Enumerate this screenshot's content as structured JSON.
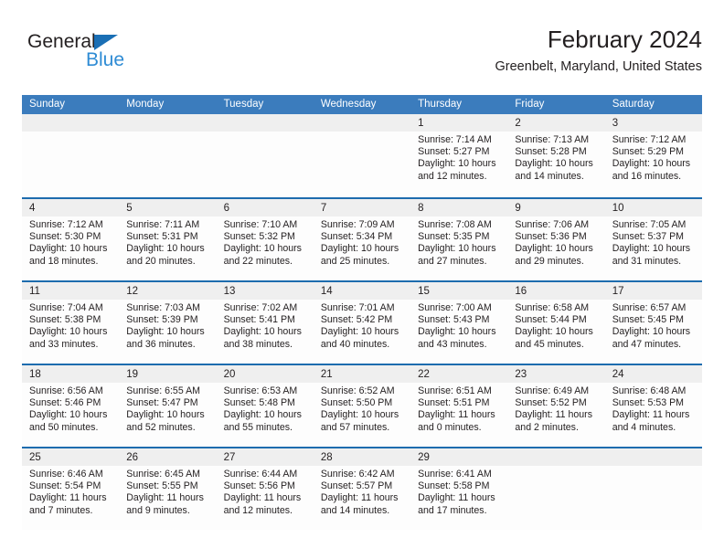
{
  "brand": {
    "name_part1": "General",
    "name_part2": "Blue",
    "triangle_color": "#1a6fb5",
    "text_color": "#231f20",
    "blue_color": "#2e8bd4"
  },
  "header": {
    "title": "February 2024",
    "subtitle": "Greenbelt, Maryland, United States"
  },
  "theme": {
    "header_bg": "#3b7cbd",
    "week_divider": "#1d6cae",
    "date_band_bg": "#efefef",
    "cell_bg": "#fdfdfd",
    "text": "#231f20"
  },
  "calendar": {
    "weekday_headers": [
      "Sunday",
      "Monday",
      "Tuesday",
      "Wednesday",
      "Thursday",
      "Friday",
      "Saturday"
    ],
    "weeks": [
      [
        {
          "date": "",
          "lines": []
        },
        {
          "date": "",
          "lines": []
        },
        {
          "date": "",
          "lines": []
        },
        {
          "date": "",
          "lines": []
        },
        {
          "date": "1",
          "lines": [
            "Sunrise: 7:14 AM",
            "Sunset: 5:27 PM",
            "Daylight: 10 hours",
            "and 12 minutes."
          ]
        },
        {
          "date": "2",
          "lines": [
            "Sunrise: 7:13 AM",
            "Sunset: 5:28 PM",
            "Daylight: 10 hours",
            "and 14 minutes."
          ]
        },
        {
          "date": "3",
          "lines": [
            "Sunrise: 7:12 AM",
            "Sunset: 5:29 PM",
            "Daylight: 10 hours",
            "and 16 minutes."
          ]
        }
      ],
      [
        {
          "date": "4",
          "lines": [
            "Sunrise: 7:12 AM",
            "Sunset: 5:30 PM",
            "Daylight: 10 hours",
            "and 18 minutes."
          ]
        },
        {
          "date": "5",
          "lines": [
            "Sunrise: 7:11 AM",
            "Sunset: 5:31 PM",
            "Daylight: 10 hours",
            "and 20 minutes."
          ]
        },
        {
          "date": "6",
          "lines": [
            "Sunrise: 7:10 AM",
            "Sunset: 5:32 PM",
            "Daylight: 10 hours",
            "and 22 minutes."
          ]
        },
        {
          "date": "7",
          "lines": [
            "Sunrise: 7:09 AM",
            "Sunset: 5:34 PM",
            "Daylight: 10 hours",
            "and 25 minutes."
          ]
        },
        {
          "date": "8",
          "lines": [
            "Sunrise: 7:08 AM",
            "Sunset: 5:35 PM",
            "Daylight: 10 hours",
            "and 27 minutes."
          ]
        },
        {
          "date": "9",
          "lines": [
            "Sunrise: 7:06 AM",
            "Sunset: 5:36 PM",
            "Daylight: 10 hours",
            "and 29 minutes."
          ]
        },
        {
          "date": "10",
          "lines": [
            "Sunrise: 7:05 AM",
            "Sunset: 5:37 PM",
            "Daylight: 10 hours",
            "and 31 minutes."
          ]
        }
      ],
      [
        {
          "date": "11",
          "lines": [
            "Sunrise: 7:04 AM",
            "Sunset: 5:38 PM",
            "Daylight: 10 hours",
            "and 33 minutes."
          ]
        },
        {
          "date": "12",
          "lines": [
            "Sunrise: 7:03 AM",
            "Sunset: 5:39 PM",
            "Daylight: 10 hours",
            "and 36 minutes."
          ]
        },
        {
          "date": "13",
          "lines": [
            "Sunrise: 7:02 AM",
            "Sunset: 5:41 PM",
            "Daylight: 10 hours",
            "and 38 minutes."
          ]
        },
        {
          "date": "14",
          "lines": [
            "Sunrise: 7:01 AM",
            "Sunset: 5:42 PM",
            "Daylight: 10 hours",
            "and 40 minutes."
          ]
        },
        {
          "date": "15",
          "lines": [
            "Sunrise: 7:00 AM",
            "Sunset: 5:43 PM",
            "Daylight: 10 hours",
            "and 43 minutes."
          ]
        },
        {
          "date": "16",
          "lines": [
            "Sunrise: 6:58 AM",
            "Sunset: 5:44 PM",
            "Daylight: 10 hours",
            "and 45 minutes."
          ]
        },
        {
          "date": "17",
          "lines": [
            "Sunrise: 6:57 AM",
            "Sunset: 5:45 PM",
            "Daylight: 10 hours",
            "and 47 minutes."
          ]
        }
      ],
      [
        {
          "date": "18",
          "lines": [
            "Sunrise: 6:56 AM",
            "Sunset: 5:46 PM",
            "Daylight: 10 hours",
            "and 50 minutes."
          ]
        },
        {
          "date": "19",
          "lines": [
            "Sunrise: 6:55 AM",
            "Sunset: 5:47 PM",
            "Daylight: 10 hours",
            "and 52 minutes."
          ]
        },
        {
          "date": "20",
          "lines": [
            "Sunrise: 6:53 AM",
            "Sunset: 5:48 PM",
            "Daylight: 10 hours",
            "and 55 minutes."
          ]
        },
        {
          "date": "21",
          "lines": [
            "Sunrise: 6:52 AM",
            "Sunset: 5:50 PM",
            "Daylight: 10 hours",
            "and 57 minutes."
          ]
        },
        {
          "date": "22",
          "lines": [
            "Sunrise: 6:51 AM",
            "Sunset: 5:51 PM",
            "Daylight: 11 hours",
            "and 0 minutes."
          ]
        },
        {
          "date": "23",
          "lines": [
            "Sunrise: 6:49 AM",
            "Sunset: 5:52 PM",
            "Daylight: 11 hours",
            "and 2 minutes."
          ]
        },
        {
          "date": "24",
          "lines": [
            "Sunrise: 6:48 AM",
            "Sunset: 5:53 PM",
            "Daylight: 11 hours",
            "and 4 minutes."
          ]
        }
      ],
      [
        {
          "date": "25",
          "lines": [
            "Sunrise: 6:46 AM",
            "Sunset: 5:54 PM",
            "Daylight: 11 hours",
            "and 7 minutes."
          ]
        },
        {
          "date": "26",
          "lines": [
            "Sunrise: 6:45 AM",
            "Sunset: 5:55 PM",
            "Daylight: 11 hours",
            "and 9 minutes."
          ]
        },
        {
          "date": "27",
          "lines": [
            "Sunrise: 6:44 AM",
            "Sunset: 5:56 PM",
            "Daylight: 11 hours",
            "and 12 minutes."
          ]
        },
        {
          "date": "28",
          "lines": [
            "Sunrise: 6:42 AM",
            "Sunset: 5:57 PM",
            "Daylight: 11 hours",
            "and 14 minutes."
          ]
        },
        {
          "date": "29",
          "lines": [
            "Sunrise: 6:41 AM",
            "Sunset: 5:58 PM",
            "Daylight: 11 hours",
            "and 17 minutes."
          ]
        },
        {
          "date": "",
          "lines": []
        },
        {
          "date": "",
          "lines": []
        }
      ]
    ]
  }
}
